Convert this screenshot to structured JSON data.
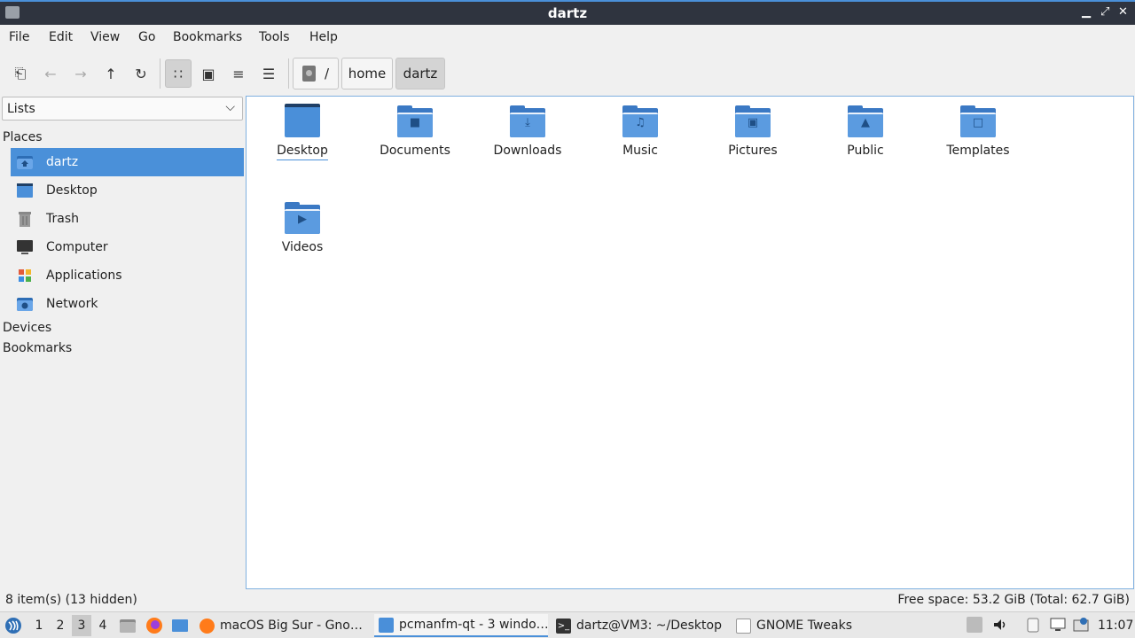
{
  "window": {
    "title": "dartz"
  },
  "menu": [
    "File",
    "Edit",
    "View",
    "Go",
    "Bookmarks",
    "Tools",
    "Help"
  ],
  "toolbar": {
    "buttons": [
      "new-tab-icon",
      "back-icon",
      "forward-icon",
      "up-icon",
      "reload-icon",
      "icon-view-icon",
      "thumbnail-view-icon",
      "compact-view-icon",
      "detailed-list-icon"
    ],
    "breadcrumbs": [
      "/",
      "home",
      "dartz"
    ]
  },
  "sidebar": {
    "mode": "Lists",
    "places_label": "Places",
    "places": [
      {
        "label": "dartz",
        "icon": "home-folder-icon"
      },
      {
        "label": "Desktop",
        "icon": "desktop-icon"
      },
      {
        "label": "Trash",
        "icon": "trash-icon"
      },
      {
        "label": "Computer",
        "icon": "computer-icon"
      },
      {
        "label": "Applications",
        "icon": "applications-icon"
      },
      {
        "label": "Network",
        "icon": "network-icon"
      }
    ],
    "devices_label": "Devices",
    "bookmarks_label": "Bookmarks"
  },
  "files": [
    {
      "name": "Desktop",
      "icon": "desktop-folder-icon"
    },
    {
      "name": "Documents",
      "icon": "documents-folder-icon"
    },
    {
      "name": "Downloads",
      "icon": "downloads-folder-icon"
    },
    {
      "name": "Music",
      "icon": "music-folder-icon"
    },
    {
      "name": "Pictures",
      "icon": "pictures-folder-icon"
    },
    {
      "name": "Public",
      "icon": "public-folder-icon"
    },
    {
      "name": "Templates",
      "icon": "templates-folder-icon"
    },
    {
      "name": "Videos",
      "icon": "videos-folder-icon"
    }
  ],
  "status": {
    "left": "8 item(s) (13 hidden)",
    "right": "Free space: 53.2 GiB (Total: 62.7 GiB)"
  },
  "taskbar": {
    "workspaces": [
      "1",
      "2",
      "3",
      "4"
    ],
    "active_workspace": "3",
    "tasks": [
      {
        "label": "macOS Big Sur - Gno…",
        "icon": "firefox-icon"
      },
      {
        "label": "pcmanfm-qt - 3 windo…",
        "icon": "file-manager-icon"
      },
      {
        "label": "dartz@VM3: ~/Desktop",
        "icon": "terminal-icon"
      },
      {
        "label": "GNOME Tweaks",
        "icon": "tweaks-icon"
      }
    ],
    "clock": "11:07"
  }
}
